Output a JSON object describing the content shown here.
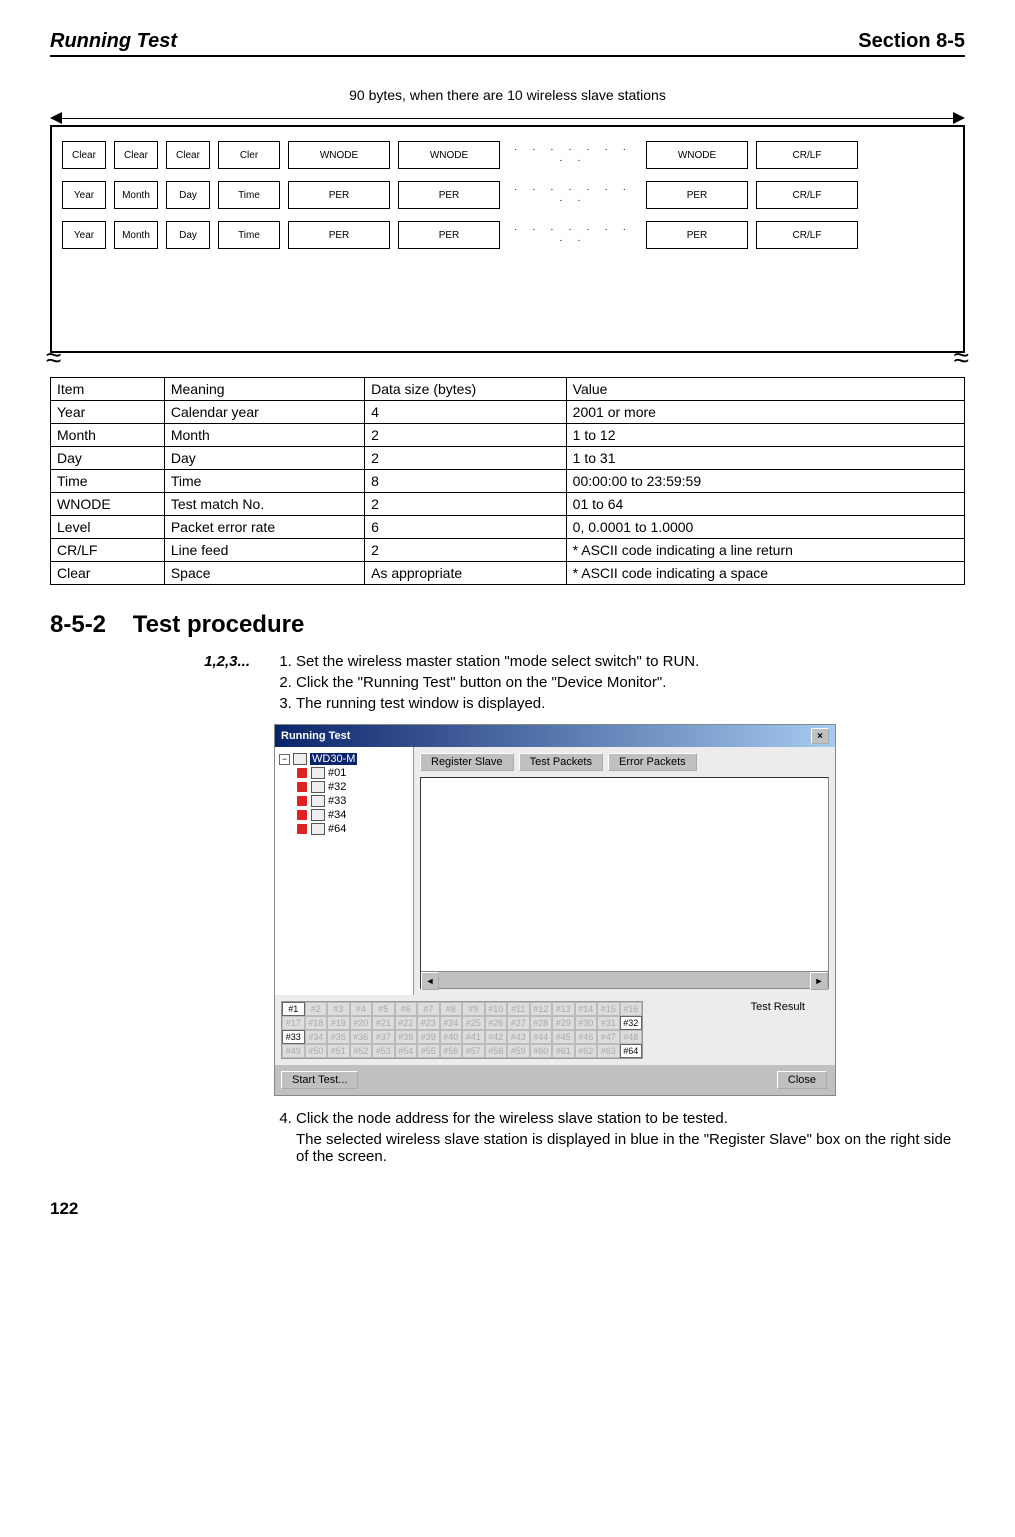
{
  "header": {
    "left": "Running Test",
    "right": "Section 8-5"
  },
  "caption": "90 bytes, when there are 10 wireless slave stations",
  "diagram": {
    "rows": [
      {
        "c1": "Clear",
        "c2": "Clear",
        "c3": "Clear",
        "c4": "Cler",
        "w1": "WNODE",
        "w2": "WNODE",
        "dots": "· · · · · · · · ·",
        "w3": "WNODE",
        "end": "CR/LF"
      },
      {
        "c1": "Year",
        "c2": "Month",
        "c3": "Day",
        "c4": "Time",
        "w1": "PER",
        "w2": "PER",
        "dots": "· · · · · · · · ·",
        "w3": "PER",
        "end": "CR/LF"
      },
      {
        "c1": "Year",
        "c2": "Month",
        "c3": "Day",
        "c4": "Time",
        "w1": "PER",
        "w2": "PER",
        "dots": "· · · · · · · · ·",
        "w3": "PER",
        "end": "CR/LF"
      }
    ]
  },
  "table": {
    "headers": {
      "item": "Item",
      "meaning": "Meaning",
      "size": "Data size (bytes)",
      "value": "Value"
    },
    "rows": [
      {
        "item": "Year",
        "meaning": "Calendar year",
        "size": "4",
        "value": "2001 or more"
      },
      {
        "item": "Month",
        "meaning": "Month",
        "size": "2",
        "value": "1 to 12"
      },
      {
        "item": "Day",
        "meaning": "Day",
        "size": "2",
        "value": "1 to 31"
      },
      {
        "item": "Time",
        "meaning": "Time",
        "size": "8",
        "value": "00:00:00 to 23:59:59"
      },
      {
        "item": "WNODE",
        "meaning": "Test match No.",
        "size": "2",
        "value": "01 to 64"
      },
      {
        "item": "Level",
        "meaning": "Packet error rate",
        "size": "6",
        "value": "0, 0.0001 to 1.0000"
      },
      {
        "item": "CR/LF",
        "meaning": "Line feed",
        "size": "2",
        "value": "* ASCII code indicating a line return"
      },
      {
        "item": "Clear",
        "meaning": "Space",
        "size": "As appropriate",
        "value": "* ASCII code indicating a space"
      }
    ]
  },
  "section": {
    "num": "8-5-2",
    "title": "Test procedure"
  },
  "stepsLabel": "1,2,3...",
  "steps": {
    "s1": "Set the wireless master station \"mode select switch\" to RUN.",
    "s2": "Click the \"Running Test\" button on the \"Device Monitor\".",
    "s3": "The running test window is displayed.",
    "s4": "Click the node address for the wireless slave station to be tested.",
    "s4b": "The selected wireless slave station is displayed in blue in the \"Register Slave\" box on the right side of the screen."
  },
  "screenshot": {
    "title": "Running Test",
    "tree": {
      "root": "WD30-M",
      "children": [
        "#01",
        "#32",
        "#33",
        "#34",
        "#64"
      ]
    },
    "buttons": {
      "register": "Register Slave",
      "testpkts": "Test Packets",
      "errpkts": "Error Packets"
    },
    "testResult": "Test Result",
    "start": "Start Test...",
    "close": "Close",
    "availableCells": [
      "#1",
      "#32",
      "#33",
      "#64"
    ],
    "gridPrefix": "#"
  },
  "pagenum": "122"
}
